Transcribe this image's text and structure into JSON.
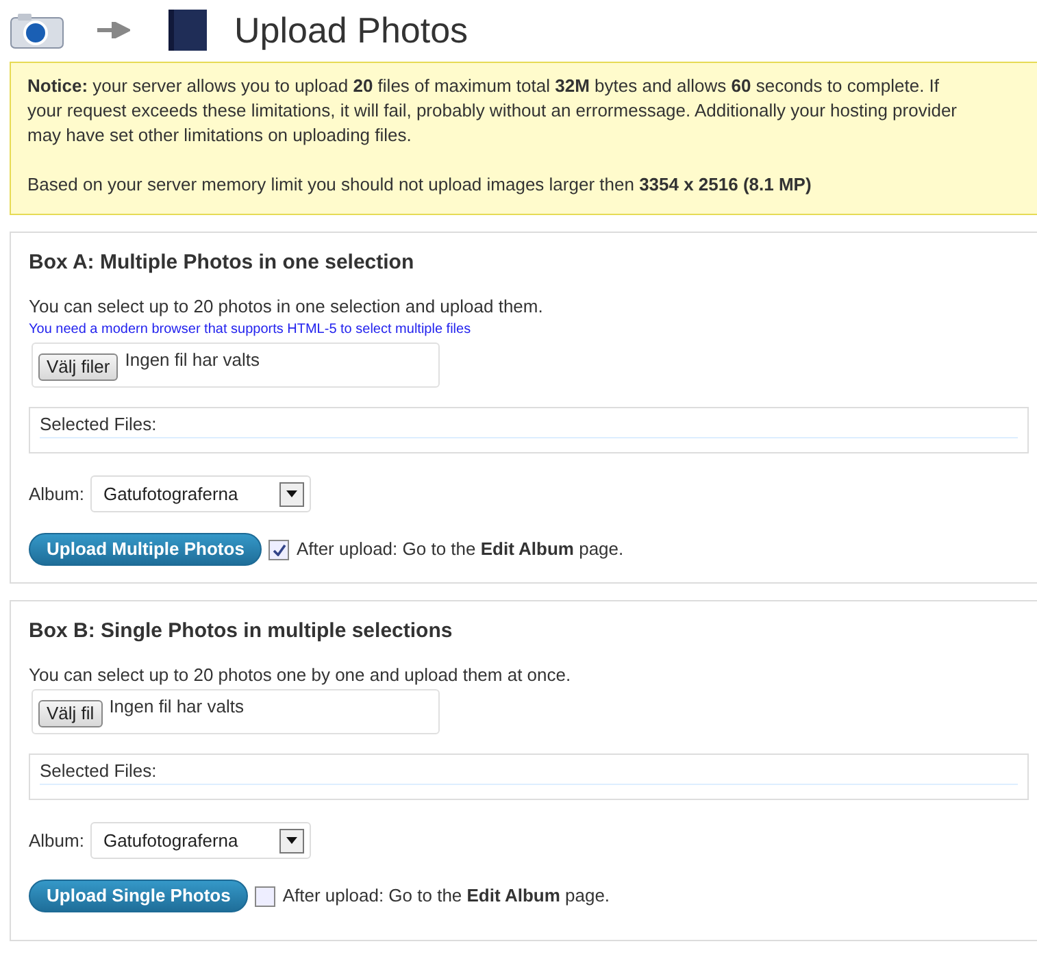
{
  "header": {
    "title": "Upload Photos"
  },
  "notice": {
    "paragraphs": [
      "**Notice:** your server allows you to upload **20** files of maximum total **32M** bytes and allows **60** seconds to complete. If your request exceeds these limitations, it will fail, probably without an errormessage. Additionally your hosting provider may have set other limitations on uploading files.",
      "Based on your server memory limit you should not upload images larger then **3354 x 2516 (8.1 MP)**"
    ]
  },
  "boxes": [
    {
      "title": "Box A: Multiple Photos in one selection",
      "description": "You can select up to 20 photos in one selection and upload them.",
      "hint": "You need a modern browser that supports HTML-5 to select multiple files",
      "file_button": "Välj filer",
      "file_status": "Ingen fil har valts",
      "selected_files_label": "Selected Files:",
      "album_label": "Album:",
      "album_value": "Gatufotograferna",
      "upload_button": "Upload Multiple Photos",
      "after_upload": {
        "label": "After upload: Go to the **Edit Album** page.",
        "checked": true
      }
    },
    {
      "title": "Box B: Single Photos in multiple selections",
      "description": "You can select up to 20 photos one by one and upload them at once.",
      "file_button": "Välj fil",
      "file_status": "Ingen fil har valts",
      "selected_files_label": "Selected Files:",
      "album_label": "Album:",
      "album_value": "Gatufotograferna",
      "upload_button": "Upload Single Photos",
      "after_upload": {
        "label": "After upload: Go to the **Edit Album** page.",
        "checked": false
      }
    }
  ]
}
